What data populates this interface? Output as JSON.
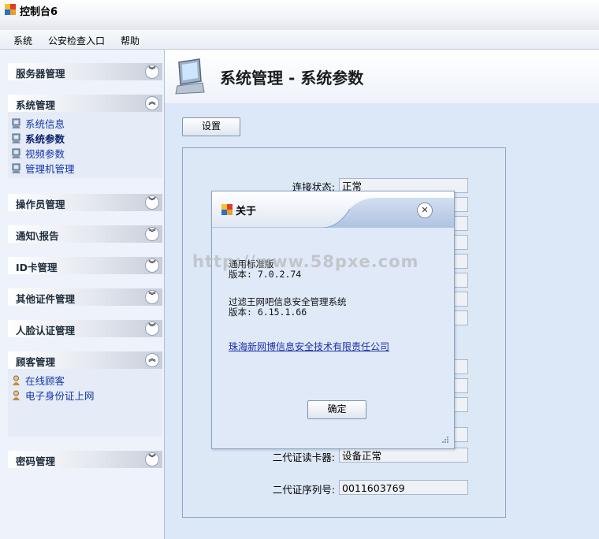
{
  "window": {
    "title": "控制台6"
  },
  "menu": [
    "系统",
    "公安检查入口",
    "帮助"
  ],
  "sidebar": {
    "panels": [
      {
        "title": "服务器管理",
        "state": "collapsed"
      },
      {
        "title": "系统管理",
        "state": "expanded",
        "items": [
          "系统信息",
          "系统参数",
          "视频参数",
          "管理机管理"
        ]
      },
      {
        "title": "操作员管理",
        "state": "collapsed"
      },
      {
        "title": "通知\\报告",
        "state": "collapsed"
      },
      {
        "title": "ID卡管理",
        "state": "collapsed"
      },
      {
        "title": "其他证件管理",
        "state": "collapsed"
      },
      {
        "title": "人脸认证管理",
        "state": "collapsed"
      },
      {
        "title": "顾客管理",
        "state": "expanded",
        "items": [
          "在线顾客",
          "电子身份证上网"
        ]
      },
      {
        "title": "密码管理",
        "state": "collapsed"
      }
    ]
  },
  "main": {
    "header_title": "系统管理 - 系统参数",
    "settings_button": "设置",
    "fields": [
      {
        "label": "连接状态:",
        "value": "正常"
      },
      {
        "label": "二代证读卡器:",
        "value": "设备正常"
      },
      {
        "label": "二代证序列号:",
        "value": "0011603769"
      }
    ]
  },
  "dialog": {
    "title": "关于",
    "product_name": "通用标准版",
    "product_version": "版本: 7.0.2.74",
    "filter_name": "过滤王网吧信息安全管理系统",
    "filter_version": "版本: 6.15.1.66",
    "company_link": "珠海新网博信息安全技术有限责任公司",
    "ok_button": "确定"
  },
  "watermark": "http://www.58pxe.com",
  "colors": {
    "link": "#1d2fa8",
    "accent": "#8ca4c8"
  }
}
